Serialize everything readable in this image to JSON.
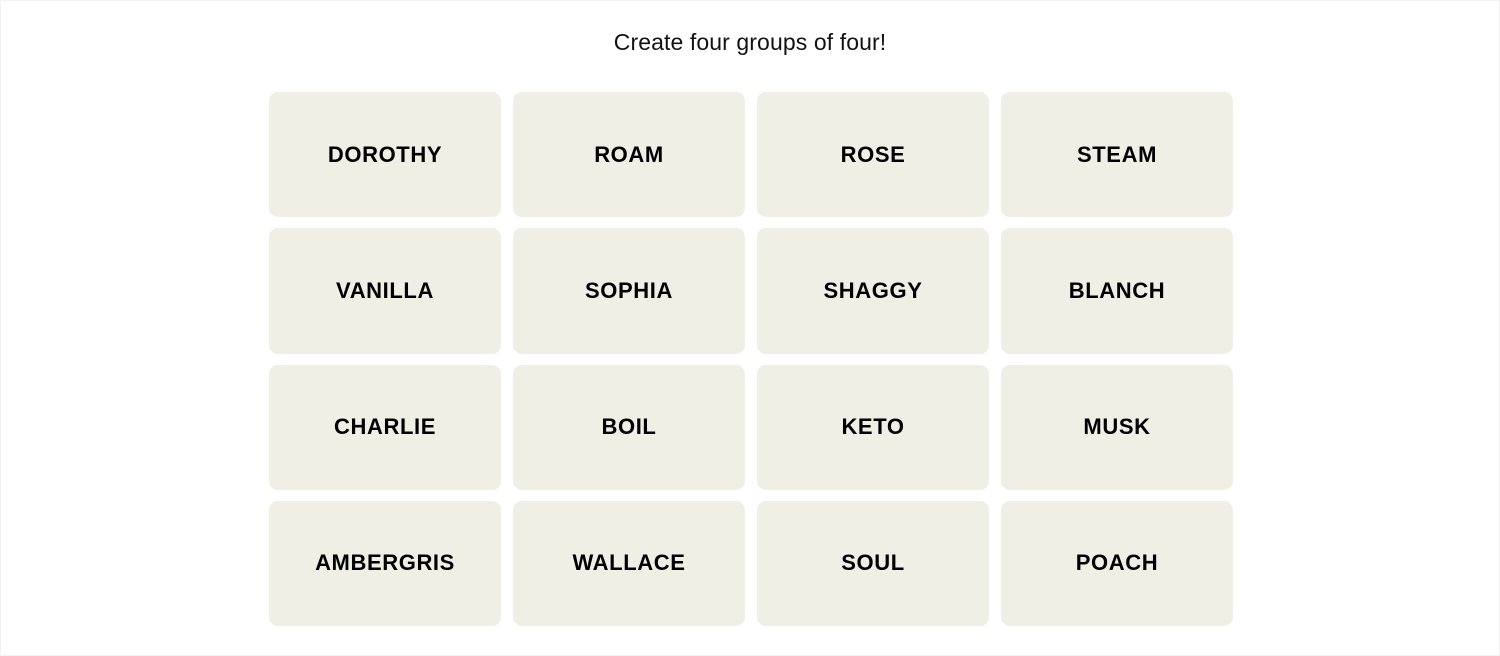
{
  "header": {
    "title": "Create four groups of four!"
  },
  "board": {
    "columns": 4,
    "rows": 4,
    "tile_color": "#efefe6",
    "text_color": "#000000",
    "page_background": "#ffffff",
    "tiles": [
      {
        "label": "DOROTHY"
      },
      {
        "label": "ROAM"
      },
      {
        "label": "ROSE"
      },
      {
        "label": "STEAM"
      },
      {
        "label": "VANILLA"
      },
      {
        "label": "SOPHIA"
      },
      {
        "label": "SHAGGY"
      },
      {
        "label": "BLANCH"
      },
      {
        "label": "CHARLIE"
      },
      {
        "label": "BOIL"
      },
      {
        "label": "KETO"
      },
      {
        "label": "MUSK"
      },
      {
        "label": "AMBERGRIS"
      },
      {
        "label": "WALLACE"
      },
      {
        "label": "SOUL"
      },
      {
        "label": "POACH"
      }
    ]
  }
}
